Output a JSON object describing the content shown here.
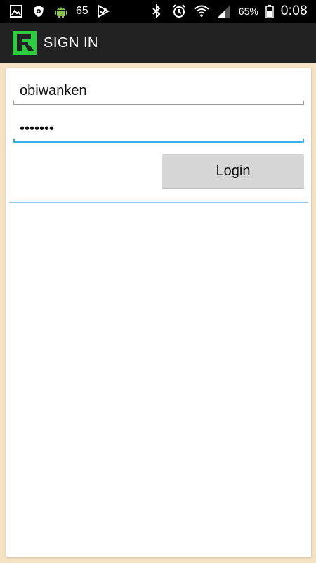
{
  "status_bar": {
    "notification_count": "65",
    "battery_percent": "65%",
    "time": "0:08",
    "icons": [
      "gallery-icon",
      "shield-icon",
      "android-icon",
      "download-check-icon",
      "bluetooth-icon",
      "alarm-icon",
      "wifi-icon",
      "signal-icon",
      "battery-icon"
    ]
  },
  "action_bar": {
    "title": "SIGN IN",
    "logo_letter": "F",
    "logo_color": "#2ecc40"
  },
  "form": {
    "username_value": "obiwanken",
    "password_value": "•••••••",
    "login_label": "Login"
  },
  "colors": {
    "accent": "#33b5e5",
    "actionbar": "#222222",
    "background": "#f3e3c3"
  }
}
